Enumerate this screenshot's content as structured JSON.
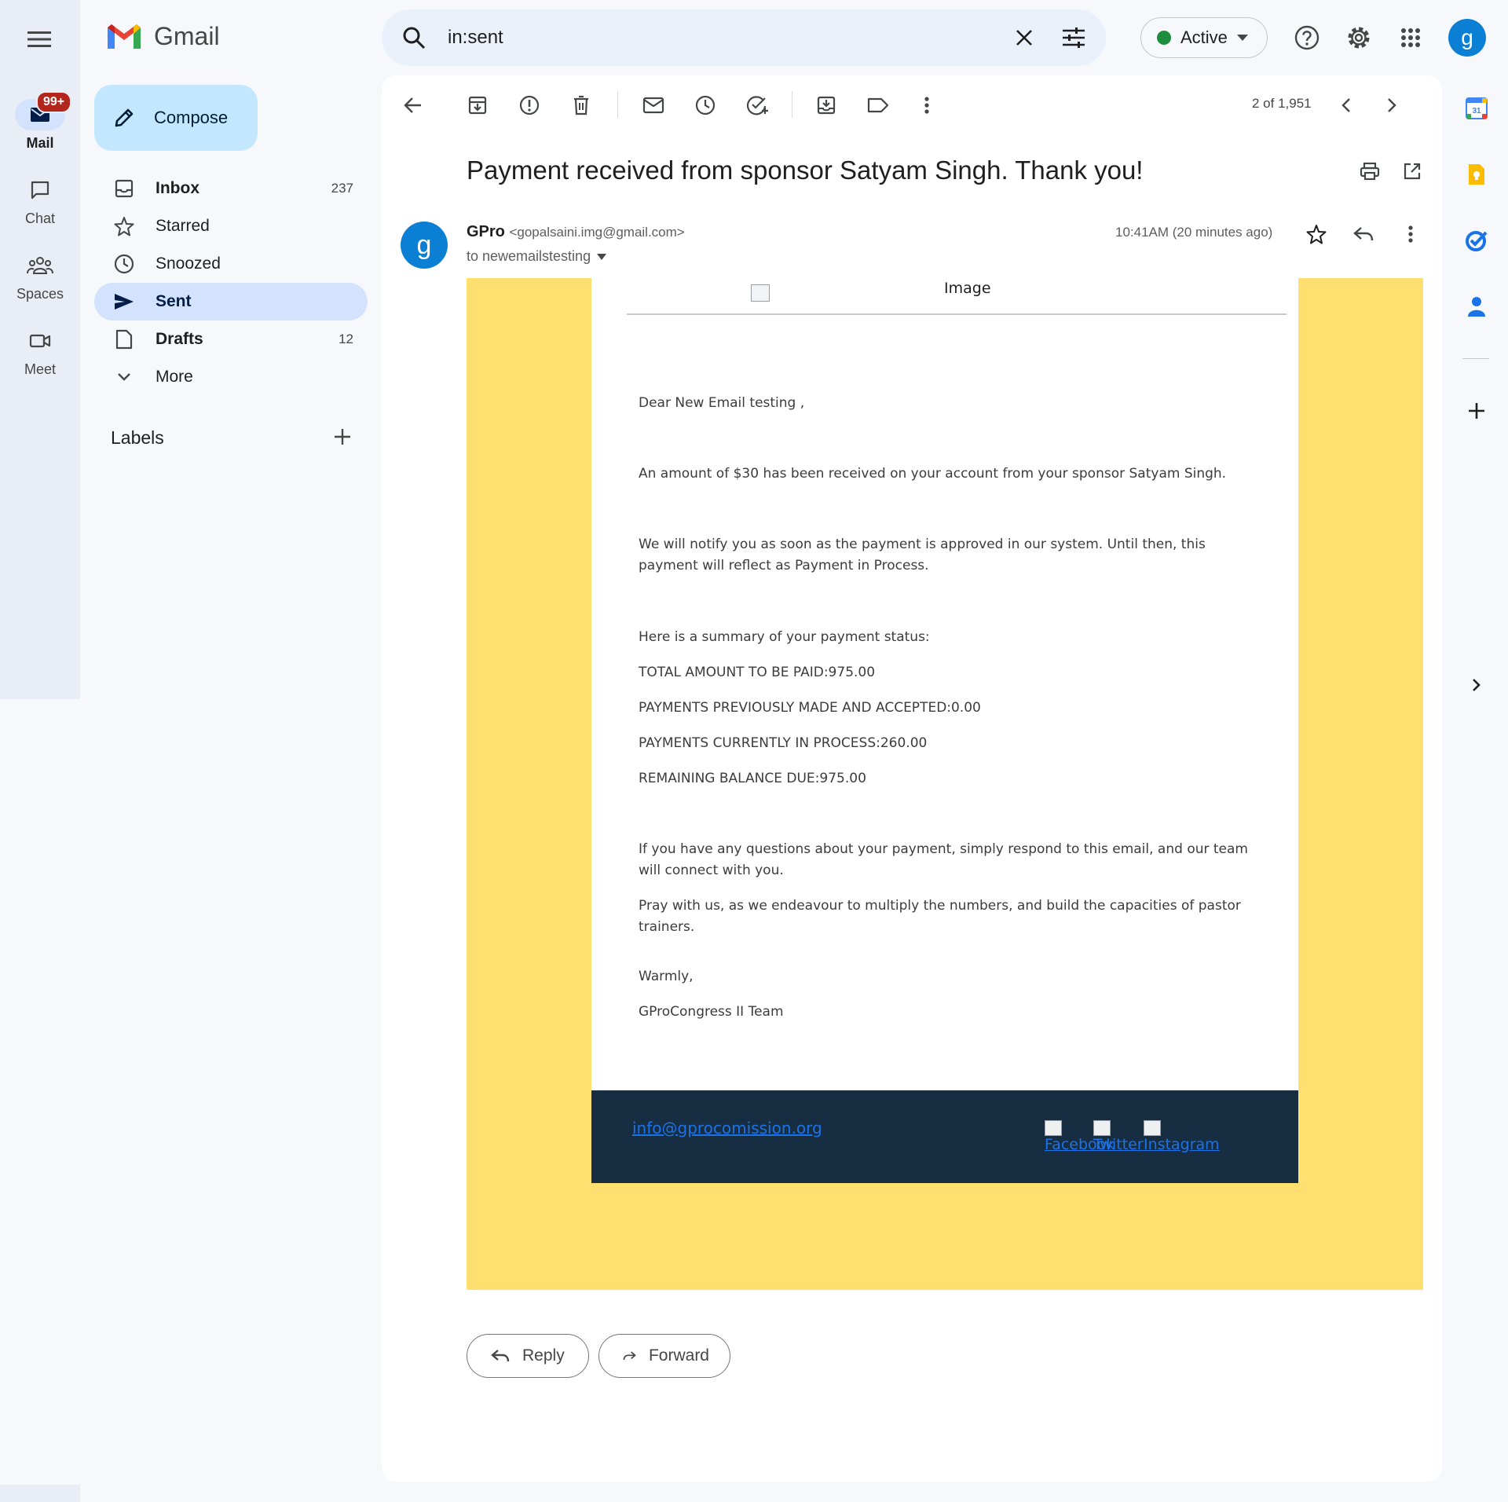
{
  "app": {
    "name": "Gmail"
  },
  "rail": {
    "items": [
      {
        "label": "Mail",
        "badge": "99+"
      },
      {
        "label": "Chat"
      },
      {
        "label": "Spaces"
      },
      {
        "label": "Meet"
      }
    ]
  },
  "search": {
    "query": "in:sent"
  },
  "status": {
    "label": "Active",
    "color": "#1e8e3e"
  },
  "account": {
    "initial": "g"
  },
  "sidebar": {
    "compose_label": "Compose",
    "items": [
      {
        "label": "Inbox",
        "count": "237",
        "icon": "inbox-icon"
      },
      {
        "label": "Starred",
        "count": "",
        "icon": "star-icon"
      },
      {
        "label": "Snoozed",
        "count": "",
        "icon": "clock-icon"
      },
      {
        "label": "Sent",
        "count": "",
        "icon": "send-icon"
      },
      {
        "label": "Drafts",
        "count": "12",
        "icon": "draft-icon"
      },
      {
        "label": "More",
        "count": "",
        "icon": "chevron-down-icon"
      }
    ],
    "labels_header": "Labels"
  },
  "toolbar": {
    "page_count": "2 of 1,951"
  },
  "message": {
    "subject": "Payment received from sponsor Satyam Singh. Thank you!",
    "sender_initial": "g",
    "sender_name": "GPro",
    "sender_email": "<gopalsaini.img@gmail.com>",
    "recipient": "to newemailstesting",
    "timestamp": "10:41AM (20 minutes ago)"
  },
  "email_body": {
    "image_alt": "Image",
    "greeting": "Dear New Email testing ,",
    "p1": "An amount of $30 has been received on your account from your sponsor Satyam Singh.",
    "p2": "We will notify you as soon as the payment is approved in our system. Until then, this payment will reflect as Payment in Process.",
    "summary_intro": "Here is a summary of your payment status:",
    "total": "TOTAL AMOUNT TO BE PAID:975.00",
    "previous": "PAYMENTS PREVIOUSLY MADE AND ACCEPTED:0.00",
    "in_process": "PAYMENTS CURRENTLY IN PROCESS:260.00",
    "remaining": "REMAINING BALANCE DUE:975.00",
    "p3": "If you have any questions about your payment, simply respond to this email, and our team will connect with you.",
    "p4": "Pray with us, as we endeavour to multiply the numbers, and build the capacities of pastor trainers.",
    "signoff": "Warmly,",
    "signature": "GProCongress II Team",
    "footer_email": "info@gprocomission.org",
    "social": [
      "Facebook",
      "Twitter",
      "Instagram"
    ],
    "colors": {
      "frame": "#ffdf6f",
      "footer": "#172e42"
    }
  },
  "actions": {
    "reply": "Reply",
    "forward": "Forward"
  }
}
